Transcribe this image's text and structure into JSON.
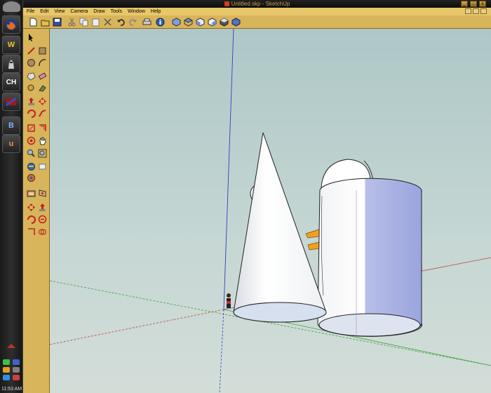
{
  "window": {
    "title": "Untitled.skp - SketchUp"
  },
  "menubar": {
    "items": [
      "File",
      "Edit",
      "View",
      "Camera",
      "Draw",
      "Tools",
      "Window",
      "Help"
    ]
  },
  "taskbar": {
    "apps": [
      {
        "icon": "firefox-icon",
        "label": ""
      },
      {
        "icon": "wow-icon",
        "label": "W"
      },
      {
        "icon": "knight-icon",
        "label": ""
      },
      {
        "icon": "ch-icon",
        "label": "CH"
      },
      {
        "icon": "flag-icon",
        "label": ""
      },
      {
        "icon": "b-icon",
        "label": "B"
      },
      {
        "icon": "u-icon",
        "label": "u"
      }
    ],
    "clock": "11:53 AM"
  },
  "toolbar": {
    "tools": [
      "new-icon",
      "open-icon",
      "save-icon",
      "cut-icon",
      "copy-icon",
      "paste-icon",
      "erase-icon",
      "undo-icon",
      "redo-icon",
      "print-icon",
      "model-info-icon",
      "iso-view-icon",
      "top-view-icon",
      "front-view-icon",
      "right-view-icon",
      "back-view-icon",
      "left-view-icon"
    ]
  },
  "lefttools": {
    "tools": [
      "select-icon",
      "line-icon",
      "rectangle-icon",
      "circle-icon",
      "arc-icon",
      "polygon-icon",
      "eraser-icon",
      "paint-icon",
      "tape-icon",
      "push-pull-icon",
      "move-icon",
      "rotate-icon",
      "follow-me-icon",
      "scale-icon",
      "offset-icon",
      "orbit-icon",
      "pan-icon",
      "zoom-icon",
      "zoom-extents-icon",
      "previous-icon",
      "position-camera-icon",
      "walk-icon",
      "look-around-icon",
      "section-icon"
    ]
  },
  "colors": {
    "chrome": "#d8b45a",
    "viewport_bg": "#c6d7d4",
    "axis_red": "#c04040",
    "axis_green": "#40a040",
    "axis_blue": "#3040c0",
    "shade": "#b8bfe8",
    "accent_orange": "#f0a020"
  }
}
